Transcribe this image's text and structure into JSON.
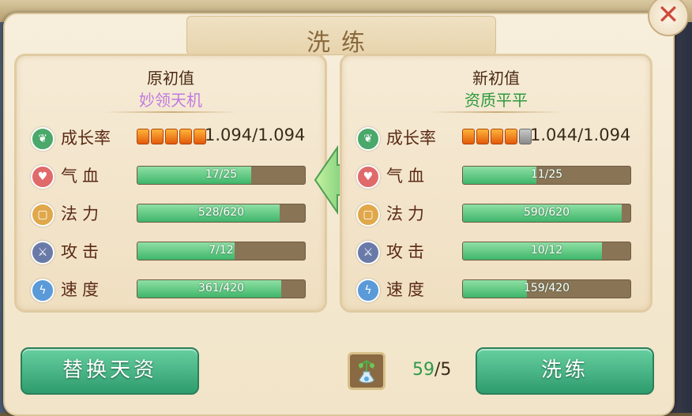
{
  "dialog": {
    "title": "洗练"
  },
  "left_panel": {
    "heading": "原初值",
    "subtitle": "妙领天机",
    "subtitle_color": "#c07ae0",
    "growth": {
      "label": "成长率",
      "filled_pips": 5,
      "total_pips": 5,
      "value": "1.094/1.094"
    },
    "stats": [
      {
        "label": "气血",
        "icon": "heart-icon",
        "text": "17/25",
        "fraction": 0.68
      },
      {
        "label": "法力",
        "icon": "scroll-icon",
        "text": "528/620",
        "fraction": 0.85
      },
      {
        "label": "攻击",
        "icon": "sword-icon",
        "text": "7/12",
        "fraction": 0.58
      },
      {
        "label": "速度",
        "icon": "lightning-icon",
        "text": "361/420",
        "fraction": 0.86
      }
    ]
  },
  "right_panel": {
    "heading": "新初值",
    "subtitle": "资质平平",
    "subtitle_color": "#2b9a3e",
    "growth": {
      "label": "成长率",
      "filled_pips": 4,
      "total_pips": 5,
      "value": "1.044/1.094"
    },
    "stats": [
      {
        "label": "气血",
        "icon": "heart-icon",
        "text": "11/25",
        "fraction": 0.44
      },
      {
        "label": "法力",
        "icon": "scroll-icon",
        "text": "590/620",
        "fraction": 0.95
      },
      {
        "label": "攻击",
        "icon": "sword-icon",
        "text": "10/12",
        "fraction": 0.83
      },
      {
        "label": "速度",
        "icon": "lightning-icon",
        "text": "159/420",
        "fraction": 0.38
      }
    ]
  },
  "buttons": {
    "replace": "替换天资",
    "refine": "洗练"
  },
  "item": {
    "icon": "potion-bottle-icon",
    "have": "59",
    "separator": "/",
    "need": "5"
  },
  "colors": {
    "bar_fill": "#4cbc74",
    "bar_track": "#8a7456",
    "accent_green": "#2f9c6e"
  }
}
